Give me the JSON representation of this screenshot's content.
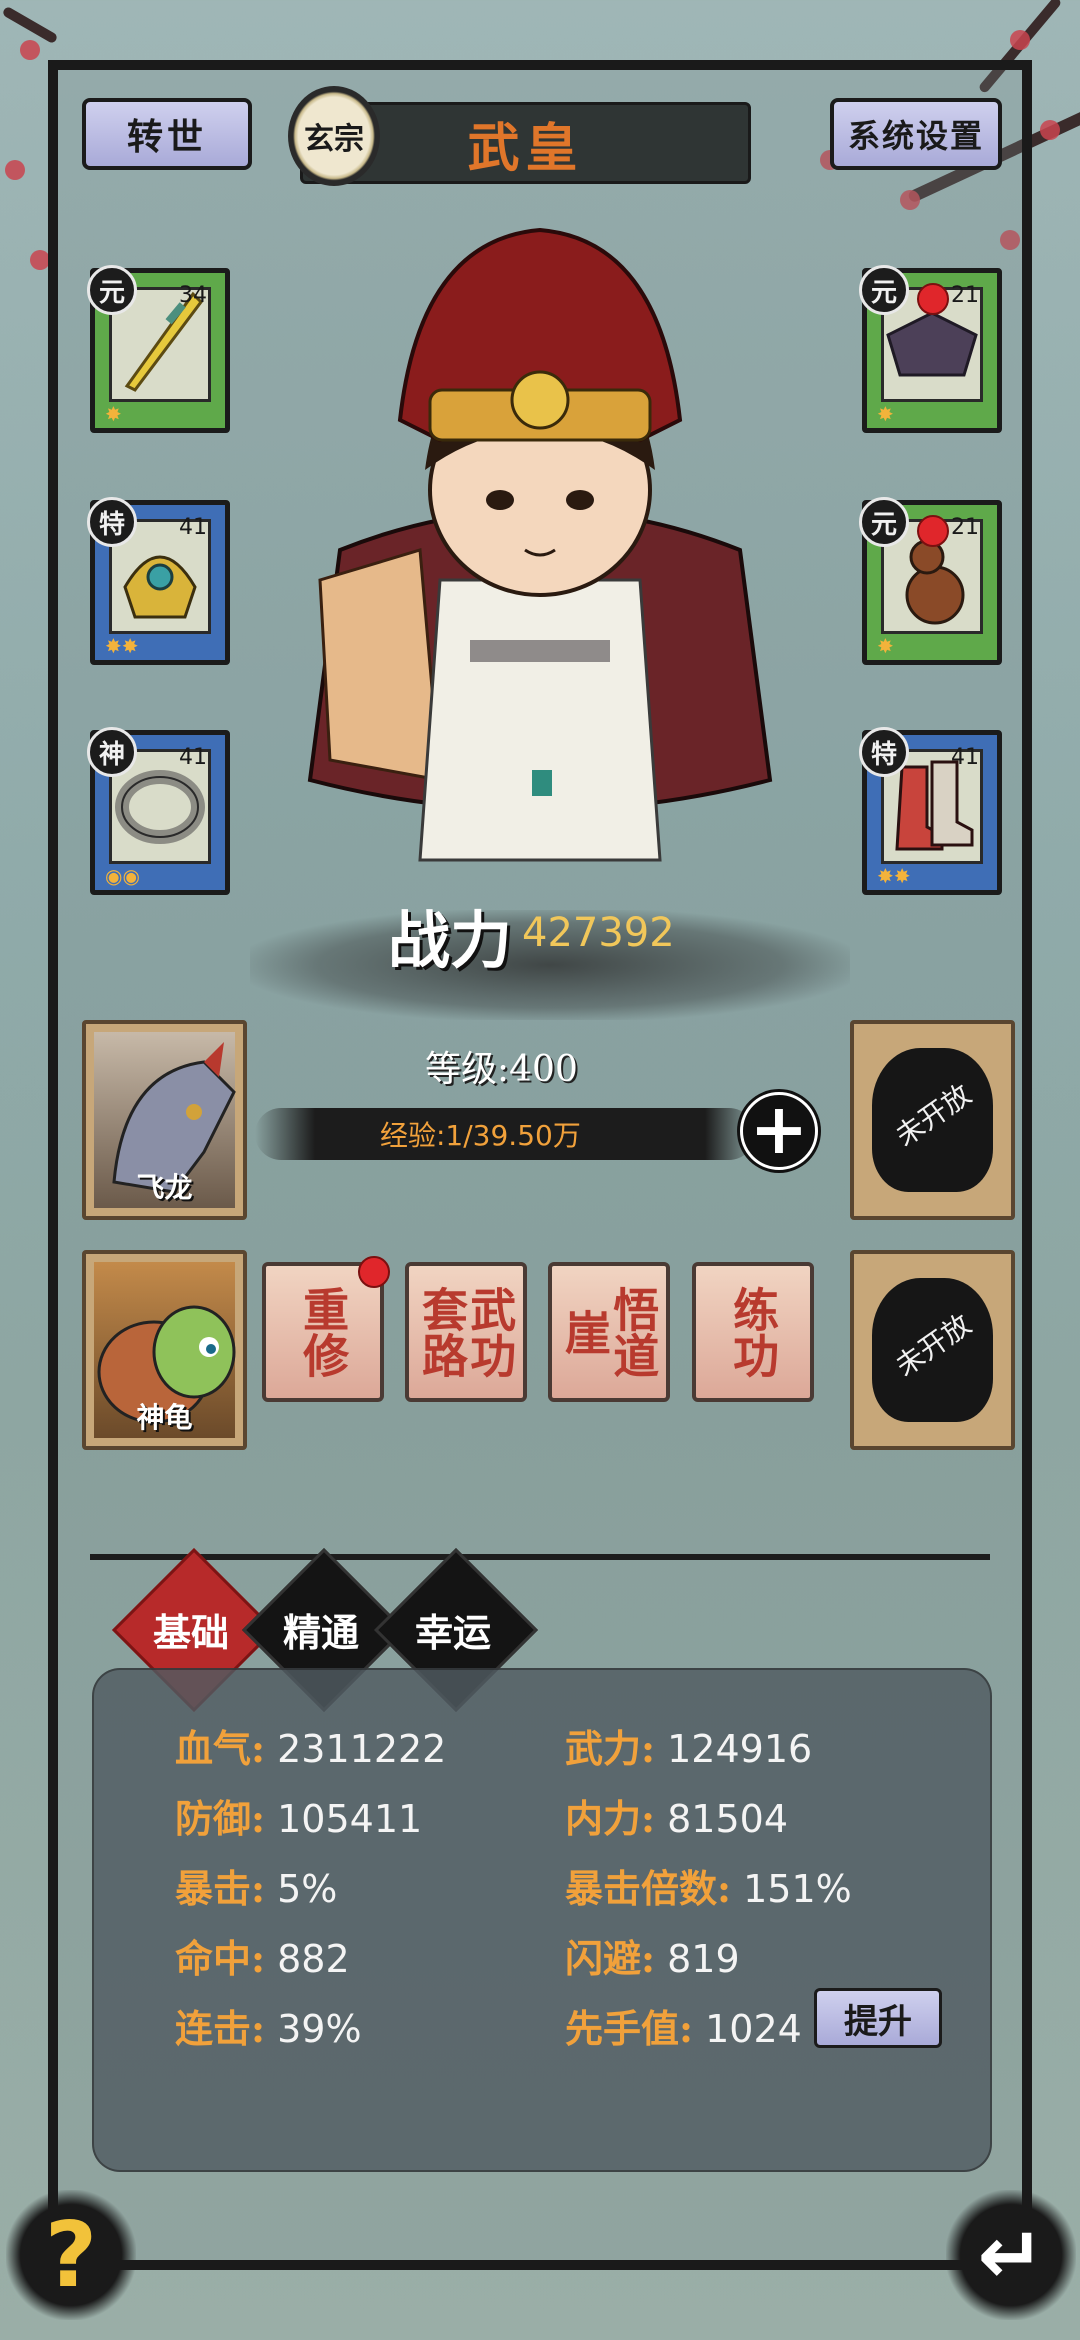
{
  "header": {
    "rebirth_label": "转世",
    "sect_badge": "玄宗",
    "title": "武皇",
    "settings_label": "系统设置"
  },
  "equipment": {
    "left": [
      {
        "grade": "元",
        "level": "34",
        "item": "sword-icon",
        "color": "green"
      },
      {
        "grade": "特",
        "level": "41",
        "item": "helmet-icon",
        "color": "blue"
      },
      {
        "grade": "神",
        "level": "41",
        "item": "ring-icon",
        "color": "blue"
      }
    ],
    "right": [
      {
        "grade": "元",
        "level": "21",
        "item": "armor-icon",
        "color": "green",
        "notice": true
      },
      {
        "grade": "元",
        "level": "21",
        "item": "gourd-icon",
        "color": "green",
        "notice": true
      },
      {
        "grade": "特",
        "level": "41",
        "item": "boots-icon",
        "color": "blue"
      }
    ]
  },
  "power": {
    "label": "战力",
    "value": "427392"
  },
  "level": {
    "label": "等级:",
    "value": "400"
  },
  "exp": {
    "text": "经验:1/39.50万"
  },
  "pets": [
    {
      "name": "飞龙",
      "icon": "dragon-icon"
    },
    {
      "name": "神龟",
      "icon": "turtle-icon"
    }
  ],
  "locked_slots": [
    "未开放",
    "未开放"
  ],
  "skills": [
    {
      "label": "重修",
      "notice": true
    },
    {
      "label": "武功套路",
      "notice": false
    },
    {
      "label": "悟道崖",
      "notice": false
    },
    {
      "label": "练功",
      "notice": false
    }
  ],
  "tabs": [
    "基础",
    "精通",
    "幸运"
  ],
  "stats": {
    "hp": {
      "label": "血气:",
      "value": "2311222"
    },
    "atk": {
      "label": "武力:",
      "value": "124916"
    },
    "def": {
      "label": "防御:",
      "value": "105411"
    },
    "inner": {
      "label": "内力:",
      "value": "81504"
    },
    "crit": {
      "label": "暴击:",
      "value": "5%"
    },
    "crit_mult": {
      "label": "暴击倍数:",
      "value": "151%"
    },
    "hit": {
      "label": "命中:",
      "value": "882"
    },
    "dodge": {
      "label": "闪避:",
      "value": "819"
    },
    "combo": {
      "label": "连击:",
      "value": "39%"
    },
    "initiative": {
      "label": "先手值:",
      "value": "1024"
    }
  },
  "upgrade_label": "提升",
  "help_label": "?",
  "back_label": "↵"
}
